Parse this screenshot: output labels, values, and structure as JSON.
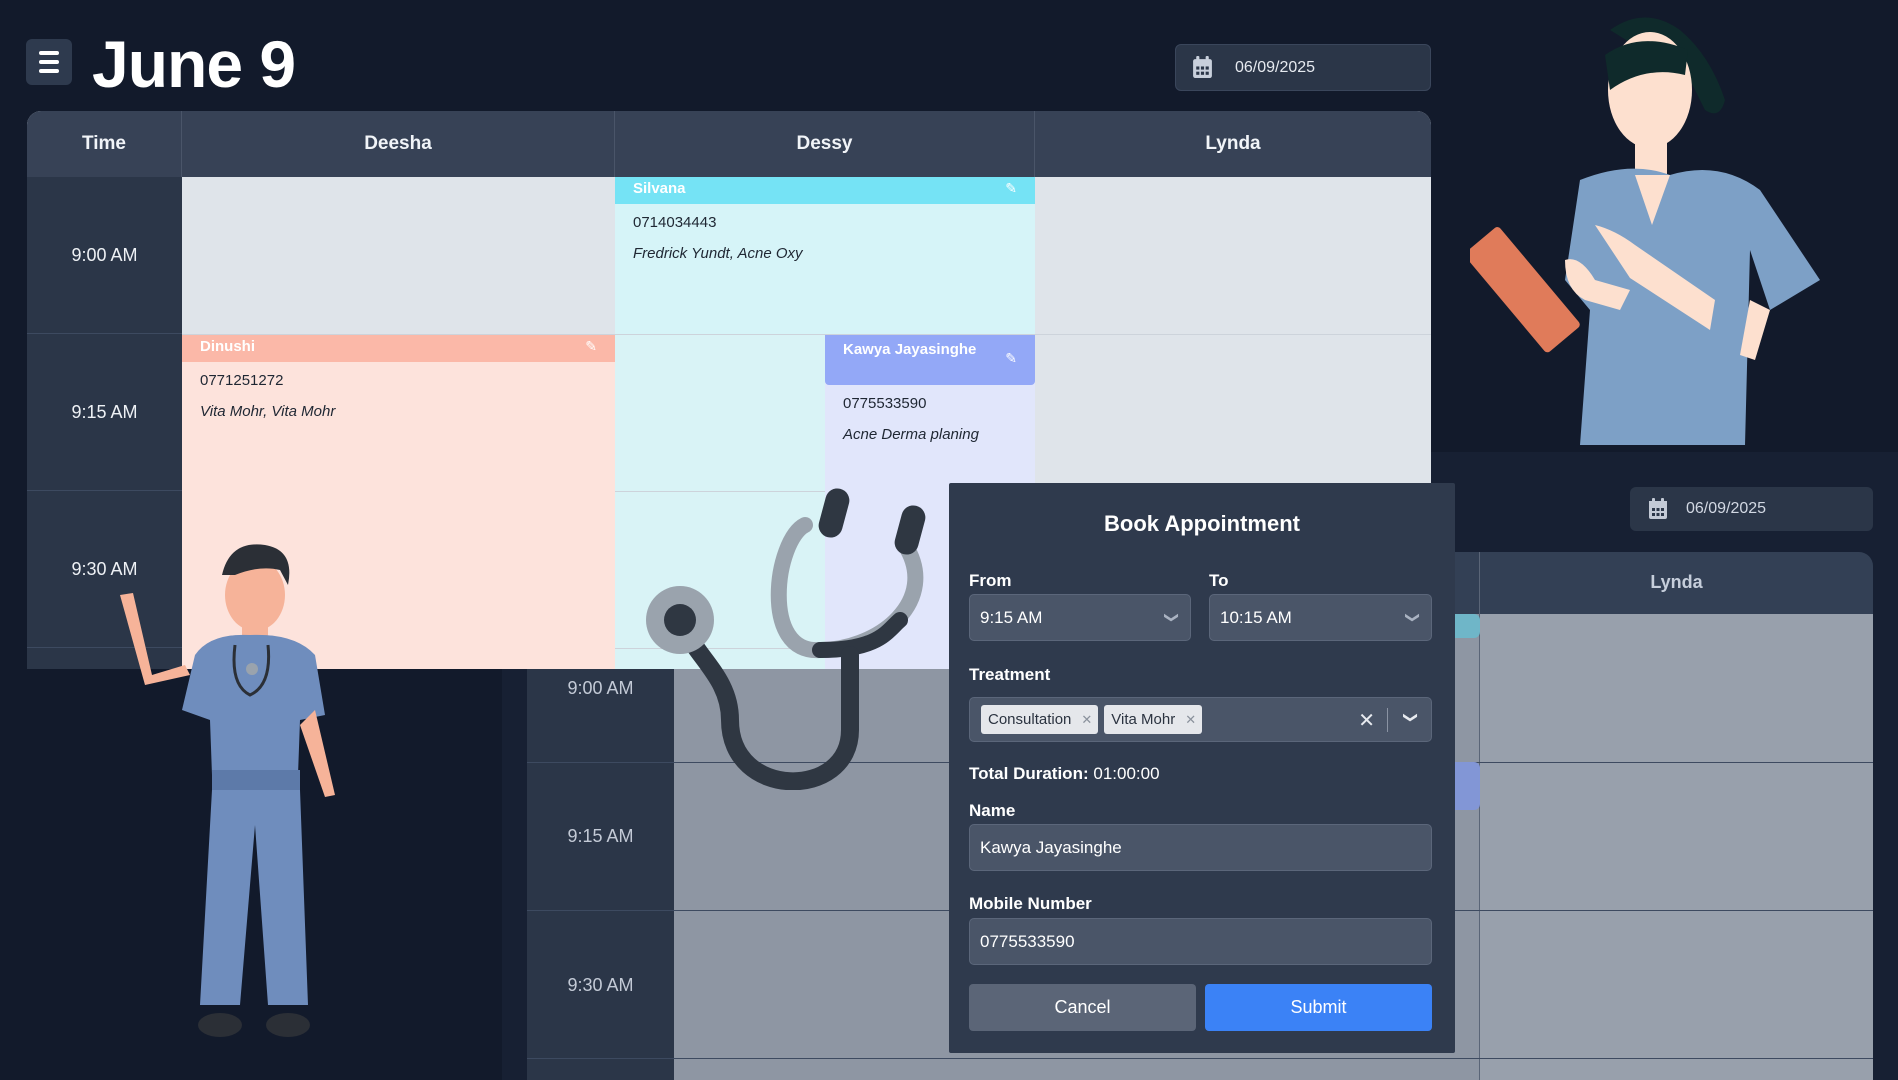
{
  "header": {
    "title": "June 9",
    "date": "06/09/2025",
    "menu_icon": "hamburger-icon",
    "calendar_icon": "calendar-icon"
  },
  "schedule": {
    "columns": [
      "Time",
      "Deesha",
      "Dessy",
      "Lynda"
    ],
    "times": [
      "9:00 AM",
      "9:15 AM",
      "9:30 AM"
    ],
    "appointments": [
      {
        "name": "Silvana",
        "phone": "0714034443",
        "note": "Fredrick Yundt, Acne Oxy",
        "color": "#75e3f5"
      },
      {
        "name": "Dinushi",
        "phone": "0771251272",
        "note": "Vita Mohr, Vita Mohr",
        "color": "#fbb8a8"
      },
      {
        "name": "Kawya Jayasinghe",
        "phone": "0775533590",
        "note": "Acne Derma planing",
        "color": "#93a8f7"
      }
    ]
  },
  "modal": {
    "title": "Book Appointment",
    "from_label": "From",
    "from_value": "9:15 AM",
    "to_label": "To",
    "to_value": "10:15 AM",
    "treatment_label": "Treatment",
    "treatments": [
      "Consultation",
      "Vita Mohr"
    ],
    "duration_label": "Total Duration:",
    "duration_value": "01:00:00",
    "name_label": "Name",
    "name_value": "Kawya Jayasinghe",
    "mobile_label": "Mobile Number",
    "mobile_value": "0775533590",
    "cancel_label": "Cancel",
    "submit_label": "Submit",
    "submit_color": "#3b82f6"
  },
  "background_screen": {
    "date": "06/09/2025",
    "column": "Lynda",
    "times": [
      "9:00 AM",
      "9:15 AM",
      "9:30 AM"
    ]
  }
}
